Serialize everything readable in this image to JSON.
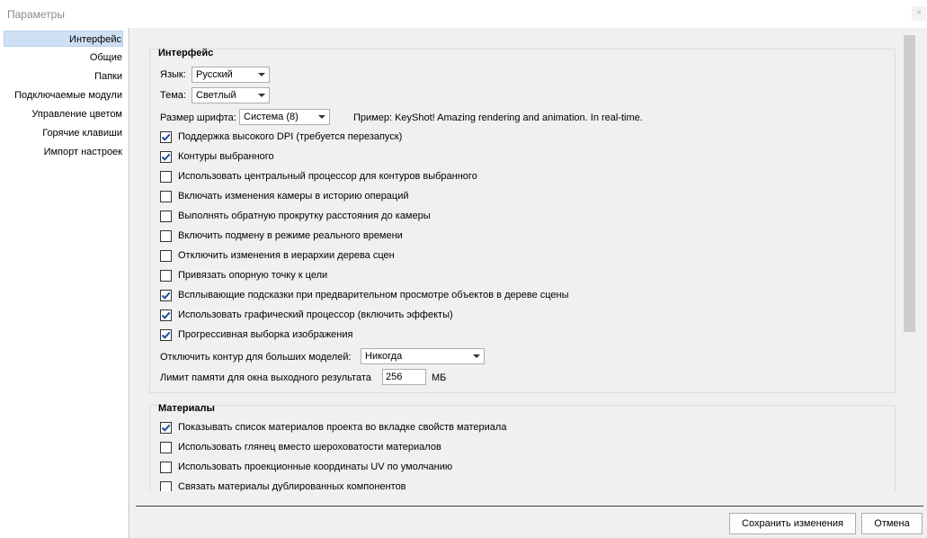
{
  "window": {
    "title": "Параметры",
    "close_label": "×"
  },
  "sidebar": {
    "items": [
      {
        "label": "Интерфейс",
        "selected": true
      },
      {
        "label": "Общие"
      },
      {
        "label": "Папки"
      },
      {
        "label": "Подключаемые модули"
      },
      {
        "label": "Управление цветом"
      },
      {
        "label": "Горячие клавиши"
      },
      {
        "label": "Импорт настроек"
      }
    ]
  },
  "interface": {
    "title": "Интерфейс",
    "language_label": "Язык:",
    "language_value": "Русский",
    "theme_label": "Тема:",
    "theme_value": "Светлый",
    "font_size_label": "Размер шрифта:",
    "font_size_value": "Система (8)",
    "preview_text": "Пример: KeyShot! Amazing rendering and animation. In real-time.",
    "checkboxes": [
      {
        "label": "Поддержка высокого DPI (требуется перезапуск)",
        "checked": true
      },
      {
        "label": "Контуры выбранного",
        "checked": true
      },
      {
        "label": "Использовать центральный процессор для контуров выбранного",
        "checked": false
      },
      {
        "label": "Включать изменения камеры в историю операций",
        "checked": false
      },
      {
        "label": "Выполнять обратную прокрутку расстояния до камеры",
        "checked": false
      },
      {
        "label": "Включить подмену в режиме реального времени",
        "checked": false
      },
      {
        "label": "Отключить изменения в иерархии дерева сцен",
        "checked": false
      },
      {
        "label": "Привязать опорную точку к цели",
        "checked": false
      },
      {
        "label": "Всплывающие подсказки при предварительном просмотре объектов в дереве сцены",
        "checked": true
      },
      {
        "label": "Использовать графический процессор (включить эффекты)",
        "checked": true
      },
      {
        "label": "Прогрессивная выборка изображения",
        "checked": true
      }
    ],
    "disable_outline_label": "Отключить контур для больших моделей:",
    "disable_outline_value": "Никогда",
    "memory_limit_label": "Лимит памяти для окна выходного результата",
    "memory_limit_value": "256",
    "memory_limit_unit": "МБ"
  },
  "materials": {
    "title": "Материалы",
    "checkboxes": [
      {
        "label": "Показывать список материалов проекта во вкладке свойств материала",
        "checked": true
      },
      {
        "label": "Использовать глянец вместо шероховатости материалов",
        "checked": false
      },
      {
        "label": "Использовать проекционные координаты UV по умолчанию",
        "checked": false
      },
      {
        "label": "Связать материалы дублированных компонентов",
        "checked": false
      }
    ]
  },
  "footer": {
    "save_label": "Сохранить изменения",
    "cancel_label": "Отмена"
  },
  "colors": {
    "selected_bg": "#cfe0f5",
    "check_color": "#1f4e9e"
  }
}
